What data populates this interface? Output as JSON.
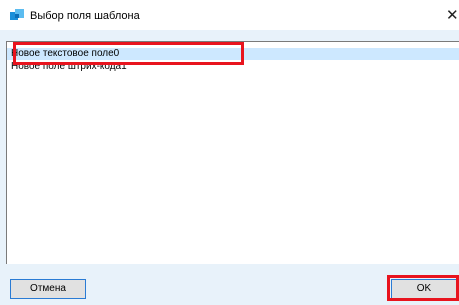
{
  "window": {
    "title": "Выбор поля шаблона",
    "close_glyph": "✕"
  },
  "list": {
    "items": [
      {
        "label": "Новое текстовое поле0",
        "selected": true
      },
      {
        "label": "Новое поле штрих-кода1",
        "selected": false
      }
    ]
  },
  "buttons": {
    "cancel_label": "Отмена",
    "ok_label": "OK"
  },
  "colors": {
    "accent_blue": "#2a7bd4",
    "selection": "#cde8ff",
    "highlight_red": "#e8141e",
    "client_bg": "#e8f2fa"
  }
}
